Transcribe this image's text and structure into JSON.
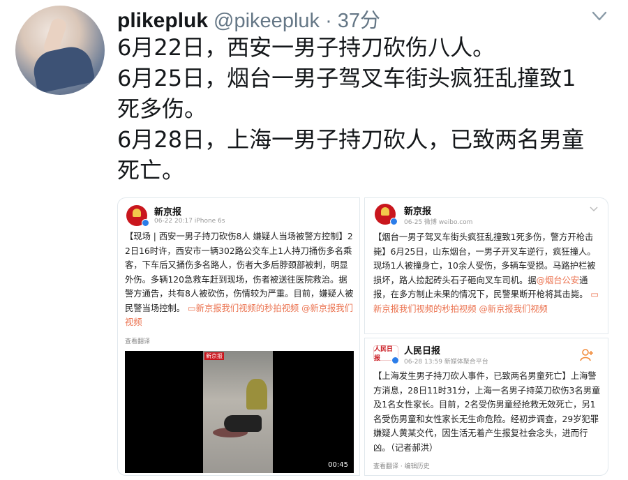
{
  "tweet": {
    "display_name": "plikepluk",
    "handle": "@pikeepluk · 37分",
    "lines": [
      "6月22日，西安一男子持刀砍伤八人。",
      "6月25日，烟台一男子驾叉车街头疯狂乱撞致1",
      "死多伤。",
      "6月28日，上海一男子持刀砍人，已致两名男童",
      "死亡。"
    ]
  },
  "card_left": {
    "source": "新京报",
    "meta": "06-22 20:17  iPhone 6s",
    "body_1": "【现场 | 西安一男子持刀砍伤8人 嫌疑人当场被警方控制】22日16时许，西安市一辆302路公交车上1人持刀捅伤多名乘客，下车后又捅伤多名路人，伤者大多后脖颈部被刺，明显外伤。多辆120急救车赶到现场，伤者被送往医院救治。据警方通告，共有8人被砍伤，伤情较为严重。目前，嫌疑人被民警当场控制。",
    "link_1": "新京报我们视频的秒拍视频 @新京报我们视频",
    "translate": "查看翻译",
    "video_tag": "新京报",
    "video_time": "00:45"
  },
  "card_right_top": {
    "source": "新京报",
    "meta": "06-25  微博 weibo.com",
    "body_1": "【烟台一男子驾叉车街头疯狂乱撞致1死多伤，警方开枪击毙】6月25日，山东烟台，一男子开叉车逆行，疯狂撞人。现场1人被撞身亡，10余人受伤，多辆车受损。马路护栏被损坏，路人捡起砖头石子砸向叉车司机。据",
    "link_1": "@烟台公安",
    "body_2": "通报，在多方制止未果的情况下，民警果断开枪将其击毙。",
    "link_2": "新京报我们视频的秒拍视频 @新京报我们视频"
  },
  "card_right_bottom": {
    "source": "人民日报",
    "logo_text": "人民日报",
    "meta": "06-28 13:59  新媒体聚合平台",
    "body_1": "【上海发生男子持刀砍人事件，已致两名男童死亡】上海警方消息，28日11时31分，上海一名男子持菜刀砍伤3名男童及1名女性家长。目前，2名受伤男童经抢救无效死亡，另1名受伤男童和女性家长无生命危险。经初步调查，29岁犯罪嫌疑人黄某交代，因生活无着产生报复社会念头，进而行凶。（记者郝洪）",
    "translate": "查看翻译",
    "history": "编辑历史"
  },
  "colors": {
    "text": "#14171a",
    "muted": "#657786",
    "link": "#eb7350",
    "weibo_red": "#c9161d",
    "twitter_blue": "#1da1f2"
  }
}
